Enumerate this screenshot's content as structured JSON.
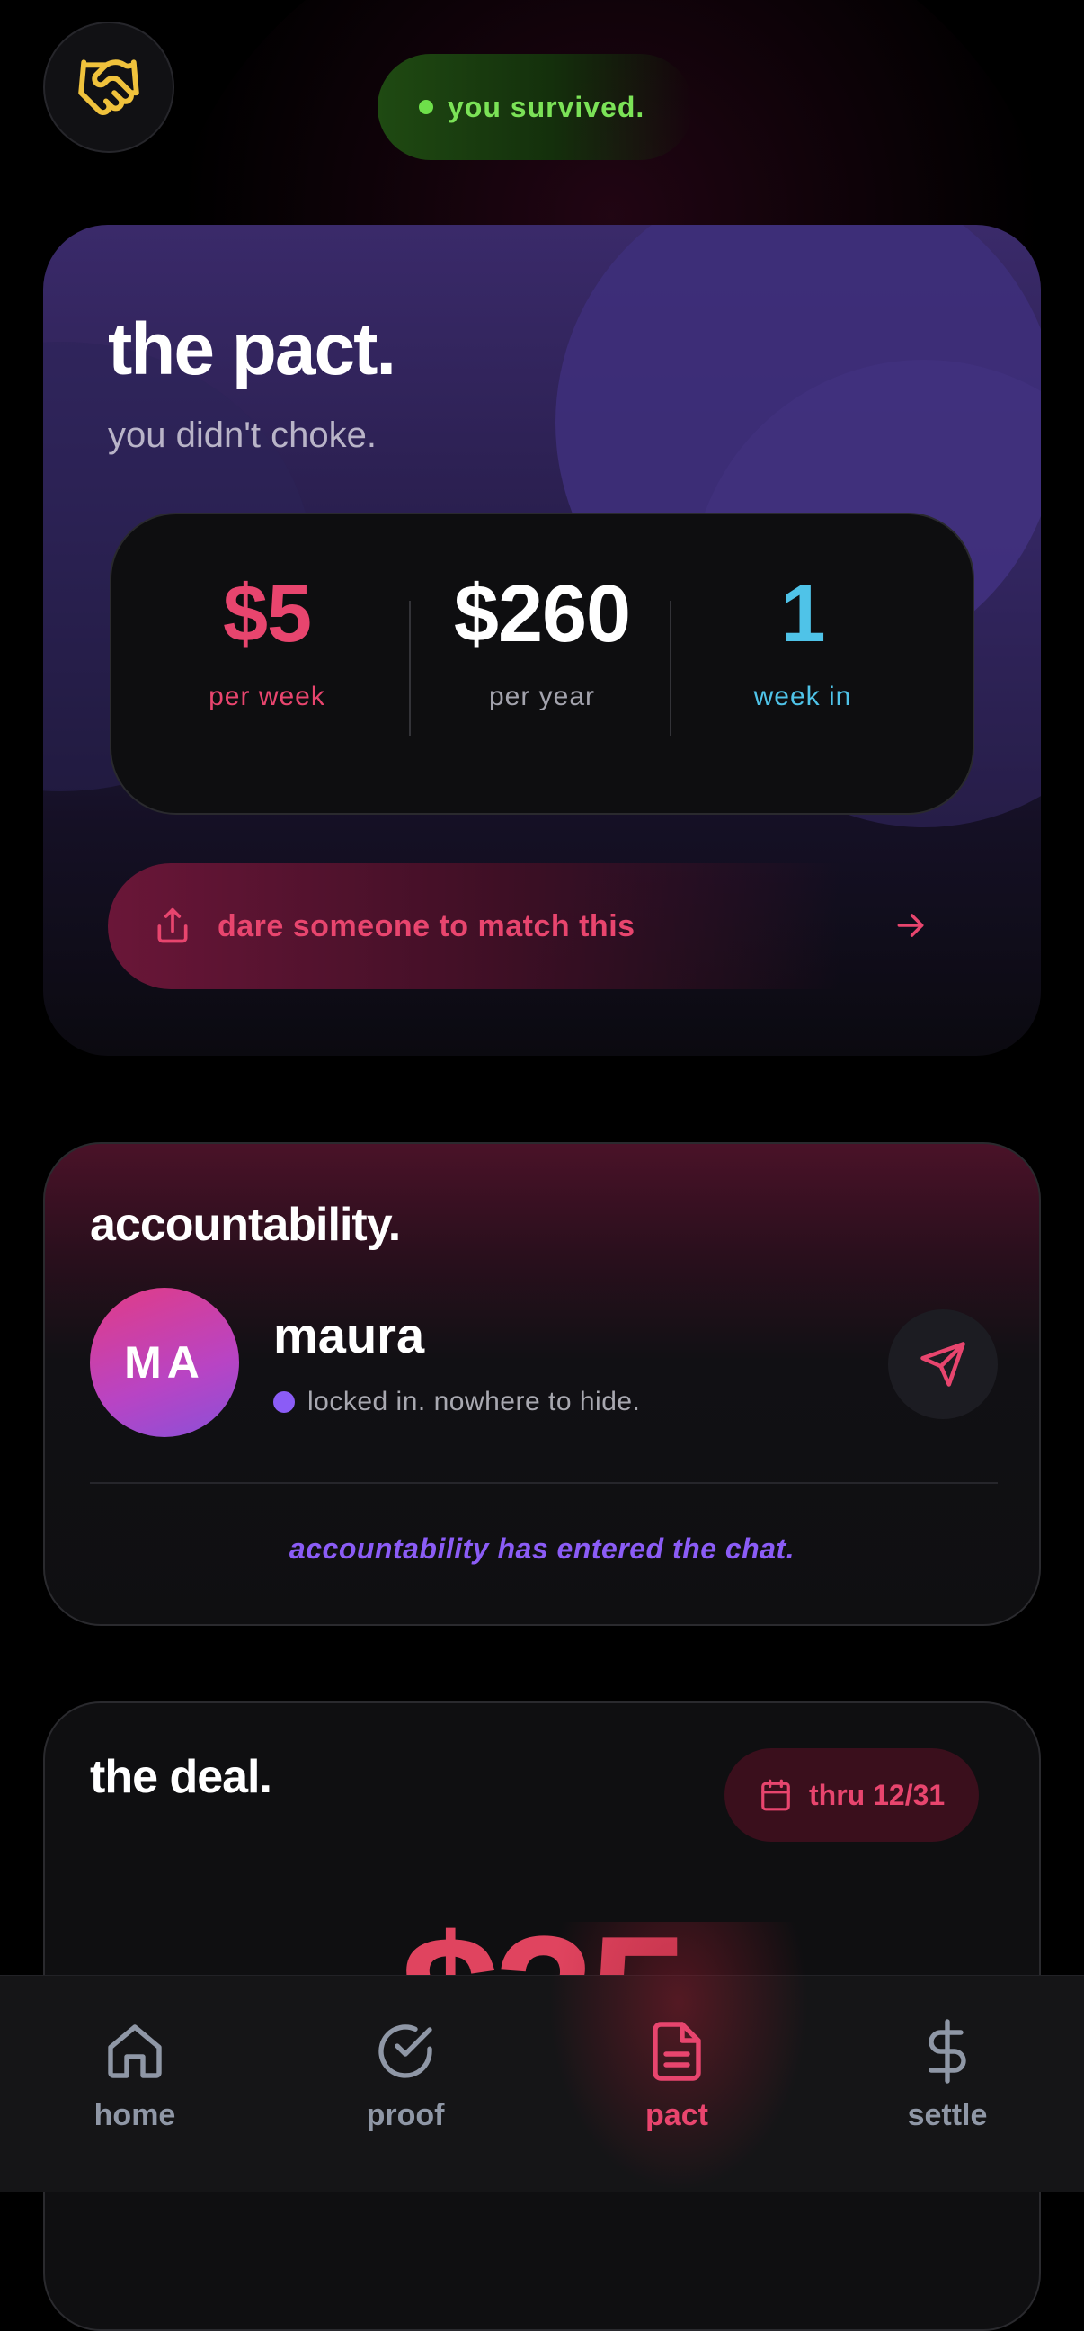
{
  "header": {
    "status_text": "you survived."
  },
  "pact": {
    "title": "the pact.",
    "subtitle": "you didn't choke.",
    "stats": [
      {
        "value": "$5",
        "label": "per week"
      },
      {
        "value": "$260",
        "label": "per year"
      },
      {
        "value": "1",
        "label": "week in"
      }
    ],
    "dare_label": "dare someone to match this"
  },
  "accountability": {
    "title": "accountability.",
    "partner_initials": "MA",
    "partner_name": "maura",
    "partner_status": "locked in. nowhere to hide.",
    "footer": "accountability has entered the chat."
  },
  "deal": {
    "title": "the deal.",
    "date_label": "thru 12/31",
    "amount": "$35"
  },
  "tabbar": {
    "tabs": [
      {
        "label": "home",
        "icon": "home-icon"
      },
      {
        "label": "proof",
        "icon": "check-circle-icon"
      },
      {
        "label": "pact",
        "icon": "document-icon"
      },
      {
        "label": "settle",
        "icon": "dollar-icon"
      }
    ],
    "active": "pact"
  },
  "colors": {
    "accent_pink": "#e8456e",
    "accent_green": "#7be257",
    "accent_purple": "#8b5cf6",
    "accent_cyan": "#4fc3e8",
    "gold": "#f0c23c"
  }
}
